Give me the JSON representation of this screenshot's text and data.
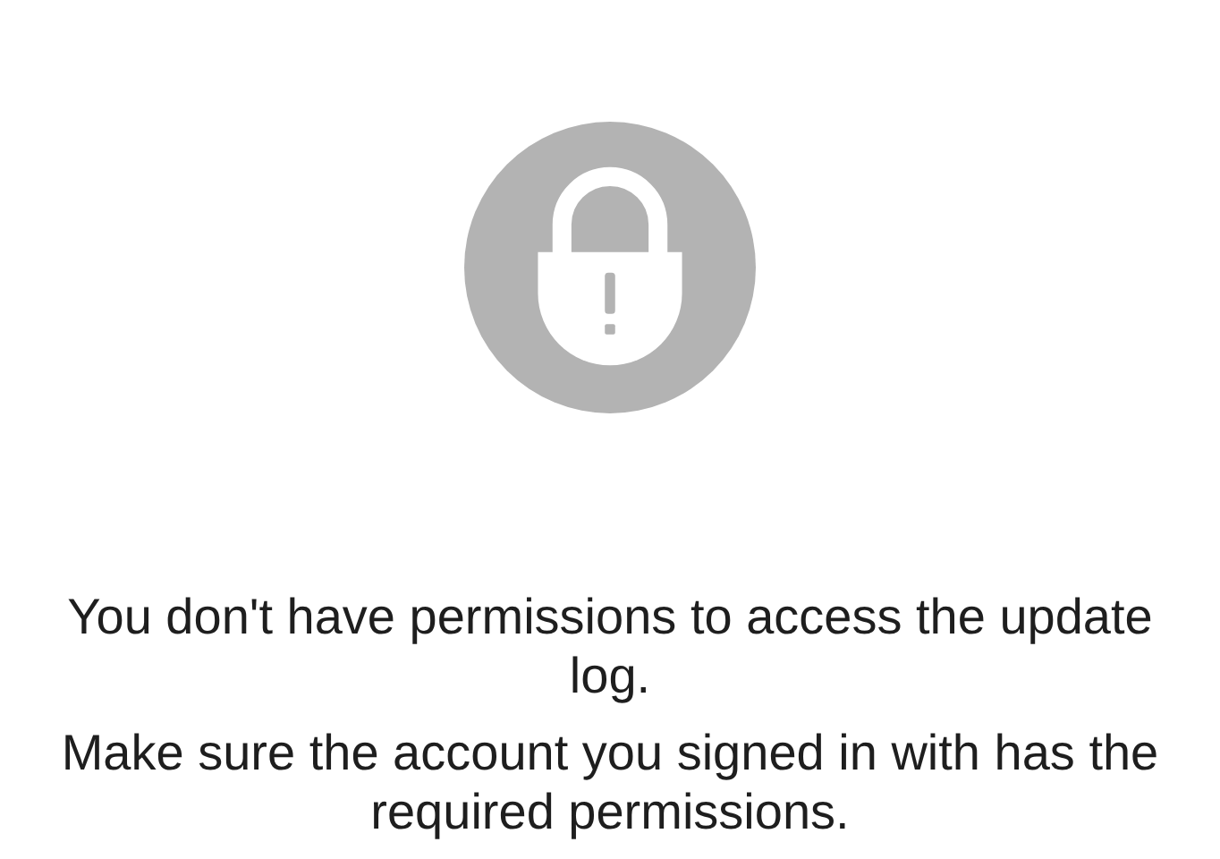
{
  "message": {
    "paragraphs": [
      "You don't have permissions to access the update log.",
      "Make sure the account you signed in with has the required permissions."
    ]
  }
}
